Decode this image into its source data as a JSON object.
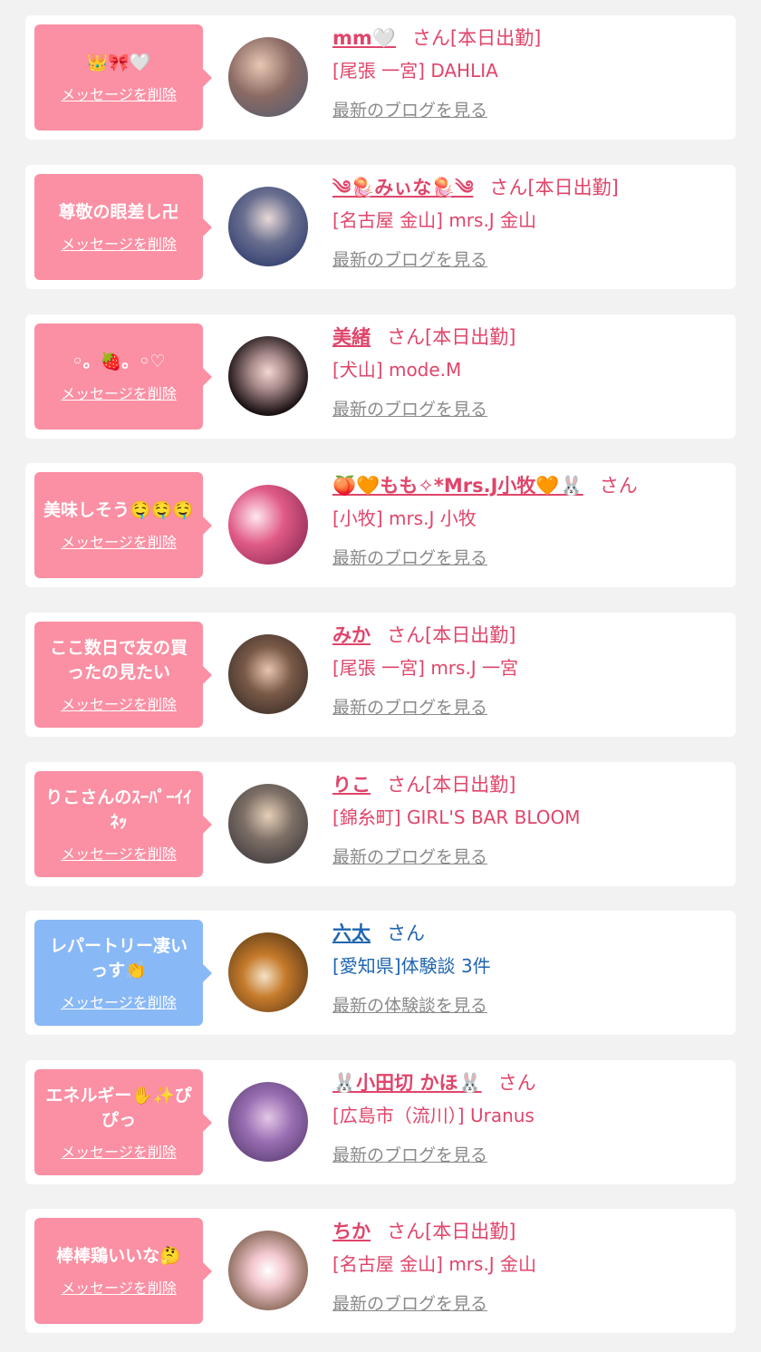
{
  "delete_label": "メッセージを削除",
  "colors": {
    "pink_bubble": "#fb8fa3",
    "blue_bubble": "#89b8f6",
    "pink_text": "#e0456a",
    "blue_text": "#1f65b0",
    "link_gray": "#8a8a8a"
  },
  "cards": [
    {
      "message": "👑🎀🤍",
      "name": "mm🤍",
      "suffix": "さん[本日出勤]",
      "shop": "[尾張 一宮] DAHLIA",
      "link": "最新のブログを見る",
      "kind": "pink",
      "avatar_icon": "avatar-photo"
    },
    {
      "message": "尊敬の眼差し卍",
      "name": "༄🪼みぃな🪼༄",
      "suffix": "さん[本日出勤]",
      "shop": "[名古屋 金山] mrs.J 金山",
      "link": "最新のブログを見る",
      "kind": "pink",
      "avatar_icon": "avatar-photo"
    },
    {
      "message": "◦。🍓。◦♡",
      "name": "美緒",
      "suffix": "さん[本日出勤]",
      "shop": "[犬山] mode.M",
      "link": "最新のブログを見る",
      "kind": "pink",
      "avatar_icon": "avatar-photo"
    },
    {
      "message": "美味しそう🤤🤤🤤",
      "name": "🍑🧡もも✧*Mrs.J小牧🧡🐰",
      "suffix": "さん",
      "shop": "[小牧] mrs.J 小牧",
      "link": "最新のブログを見る",
      "kind": "pink",
      "avatar_icon": "avatar-photo"
    },
    {
      "message": "ここ数日で友の買ったの見たい",
      "name": "みか",
      "suffix": "さん[本日出勤]",
      "shop": "[尾張 一宮] mrs.J 一宮",
      "link": "最新のブログを見る",
      "kind": "pink",
      "avatar_icon": "avatar-photo"
    },
    {
      "message": "りこさんのｽｰﾊﾟｰｲｲﾈｯ",
      "name": "りこ",
      "suffix": "さん[本日出勤]",
      "shop": "[錦糸町] GIRL'S BAR BLOOM",
      "link": "最新のブログを見る",
      "kind": "pink",
      "avatar_icon": "avatar-photo"
    },
    {
      "message": "レパートリー凄いっす👏",
      "name": "六太",
      "suffix": "さん",
      "shop": "[愛知県]体験談 3件",
      "link": "最新の体験談を見る",
      "kind": "blue",
      "avatar_icon": "avatar-photo"
    },
    {
      "message": "エネルギー✋✨ぴぴっ",
      "name": "🐰小田切 かほ🐰",
      "suffix": "さん",
      "shop": "[広島市（流川）] Uranus",
      "link": "最新のブログを見る",
      "kind": "pink",
      "avatar_icon": "avatar-photo"
    },
    {
      "message": "棒棒鶏いいな🤔",
      "name": "ちか",
      "suffix": "さん[本日出勤]",
      "shop": "[名古屋 金山] mrs.J 金山",
      "link": "最新のブログを見る",
      "kind": "pink",
      "avatar_icon": "avatar-photo"
    }
  ]
}
